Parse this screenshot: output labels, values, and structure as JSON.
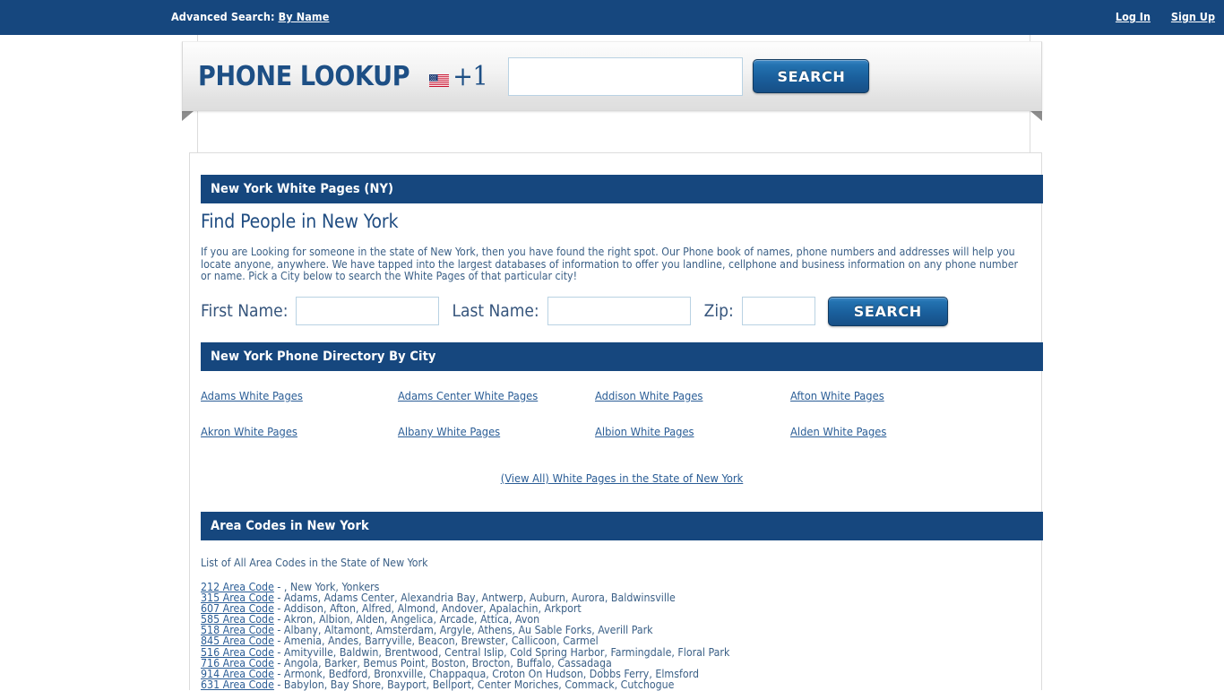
{
  "topbar": {
    "advanced_search_label": "Advanced Search:",
    "by_name_link": "By Name",
    "login_label": "Log In",
    "signup_label": "Sign Up"
  },
  "ribbon": {
    "logo_text": "PHONE LOOKUP",
    "country_code": "+1",
    "flag_icon": "us-flag-icon",
    "phone_value": "",
    "phone_placeholder": "",
    "search_label": "SEARCH"
  },
  "white_pages": {
    "section_title": "New York White Pages (NY)",
    "heading": "Find People in New York",
    "intro": "If you are Looking for someone in the state of New York, then you have found the right spot. Our Phone book of names, phone numbers and addresses will help you locate anyone, anywhere. We have tapped into the largest databases of information to offer you landline, cellphone and business information on any phone number or name. Pick a City below to search the White Pages of that particular city!",
    "form": {
      "first_name_label": "First Name:",
      "first_name_value": "",
      "last_name_label": "Last Name:",
      "last_name_value": "",
      "zip_label": "Zip:",
      "zip_value": "",
      "search_label": "SEARCH"
    }
  },
  "directory": {
    "section_title": "New York Phone Directory By City",
    "cities": [
      "Adams White Pages",
      "Adams Center White Pages",
      "Addison White Pages",
      "Afton White Pages",
      "Akron White Pages",
      "Albany White Pages",
      "Albion White Pages",
      "Alden White Pages"
    ],
    "view_all_label": "(View All) White Pages in the State of New York"
  },
  "area_codes": {
    "section_title": "Area Codes in New York",
    "intro": "List of All Area Codes in the State of New York",
    "rows": [
      {
        "code": "212 Area Code",
        "cities": " - , New York, Yonkers"
      },
      {
        "code": "315 Area Code",
        "cities": " - Adams, Adams Center, Alexandria Bay, Antwerp, Auburn, Aurora, Baldwinsville"
      },
      {
        "code": "607 Area Code",
        "cities": " - Addison, Afton, Alfred, Almond, Andover, Apalachin, Arkport"
      },
      {
        "code": "585 Area Code",
        "cities": " - Akron, Albion, Alden, Angelica, Arcade, Attica, Avon"
      },
      {
        "code": "518 Area Code",
        "cities": " - Albany, Altamont, Amsterdam, Argyle, Athens, Au Sable Forks, Averill Park"
      },
      {
        "code": "845 Area Code",
        "cities": " - Amenia, Andes, Barryville, Beacon, Brewster, Callicoon, Carmel"
      },
      {
        "code": "516 Area Code",
        "cities": " - Amityville, Baldwin, Brentwood, Central Islip, Cold Spring Harbor, Farmingdale, Floral Park"
      },
      {
        "code": "716 Area Code",
        "cities": " - Angola, Barker, Bemus Point, Boston, Brocton, Buffalo, Cassadaga"
      },
      {
        "code": "914 Area Code",
        "cities": " - Armonk, Bedford, Bronxville, Chappaqua, Croton On Hudson, Dobbs Ferry, Elmsford"
      },
      {
        "code": "631 Area Code",
        "cities": " - Babylon, Bay Shore, Bayport, Bellport, Center Moriches, Commack, Cutchogue"
      }
    ]
  },
  "colors": {
    "brand_blue": "#16477E",
    "link_blue": "#2A5D96",
    "text_blue": "#3A5F86",
    "button_blue": "#1A5F9C"
  }
}
